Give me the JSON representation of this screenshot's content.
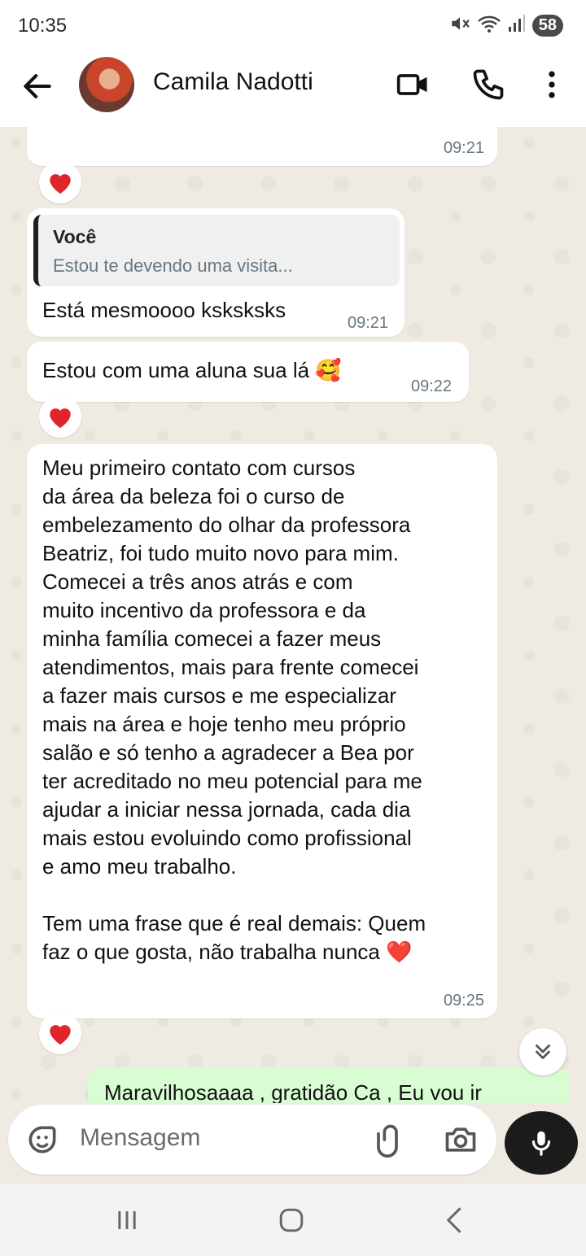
{
  "status_bar": {
    "time": "10:35",
    "battery": "58"
  },
  "header": {
    "contact_name": "Camila Nadotti"
  },
  "messages": [
    {
      "time": "09:21"
    },
    {
      "quote_author": "Você",
      "quote_text": "Estou te devendo uma visita...",
      "text": "Está mesmoooo ksksksks",
      "time": "09:21"
    },
    {
      "text": "Estou com uma aluna sua lá 🥰",
      "time": "09:22"
    },
    {
      "text": "Meu primeiro contato com cursos\nda área da beleza foi o curso de\nembelezamento do olhar da professora\nBeatriz, foi tudo muito novo para mim.\nComecei a três anos atrás e com\nmuito incentivo da professora e da\nminha família comecei a fazer meus\natendimentos, mais para frente comecei\na fazer mais cursos e me especializar\nmais na área e hoje tenho meu próprio\nsalão e só tenho a agradecer a Bea por\nter acreditado no meu potencial para me\najudar a iniciar nessa jornada, cada dia\nmais estou evoluindo como profissional\ne amo meu trabalho.\n\nTem uma frase que é real demais: Quem\nfaz o que gosta, não trabalha nunca ❤️",
      "time": "09:25"
    },
    {
      "text": "Maravilhosaaaa , gratidão Ca , Eu vou ir"
    }
  ],
  "reaction_emoji": "heart",
  "composer": {
    "placeholder": "Mensagem"
  },
  "colors": {
    "sent_bubble": "#d9fdd3",
    "received_bubble": "#ffffff",
    "chat_bg": "#efeae2",
    "reaction": "#e0242b"
  }
}
